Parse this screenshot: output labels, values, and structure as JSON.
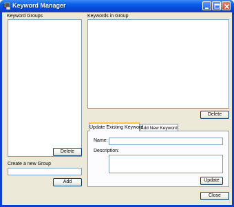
{
  "window": {
    "title": "Keyword Manager"
  },
  "groups_panel": {
    "label": "Keyword Groups",
    "delete_label": "Delete"
  },
  "keywords_panel": {
    "label": "Keywords in Group",
    "delete_label": "Delete"
  },
  "create_group": {
    "label": "Create a new Group",
    "value": "",
    "add_label": "Add"
  },
  "tabs": [
    {
      "label": "Update Existing Keyword",
      "selected": true
    },
    {
      "label": "Add New Keyword",
      "selected": false
    }
  ],
  "update_form": {
    "name_label": "Name:",
    "name_value": "",
    "description_label": "Description:",
    "description_value": "",
    "update_label": "Update"
  },
  "footer": {
    "close_label": "Close"
  }
}
